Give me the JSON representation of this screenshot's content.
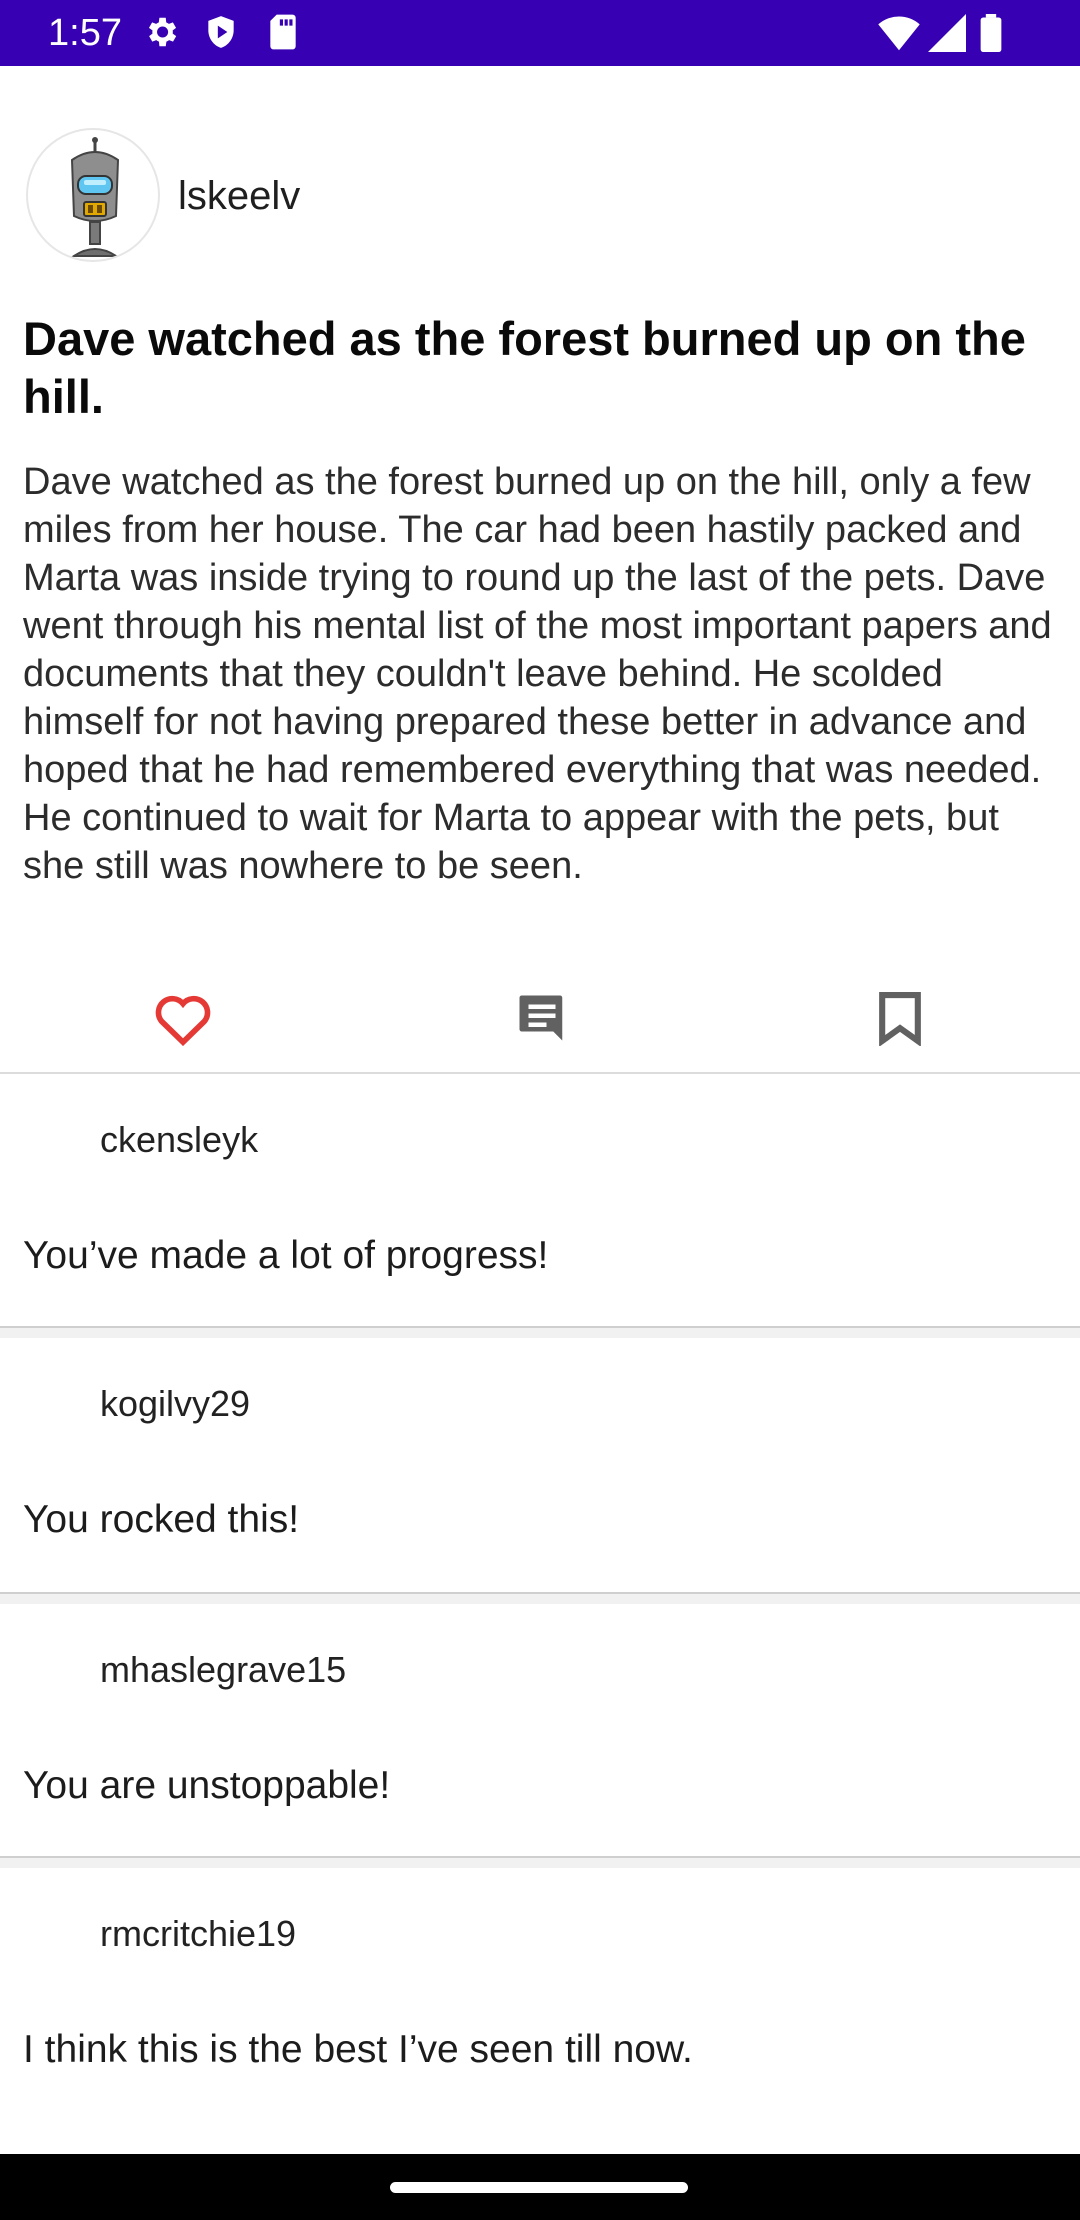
{
  "status_bar": {
    "time": "1:57",
    "icons": [
      "gear-icon",
      "shield-play-icon",
      "sd-card-icon"
    ],
    "right_icons": [
      "wifi-icon",
      "signal-icon",
      "battery-icon"
    ],
    "background": "#3700b3"
  },
  "post": {
    "author": "lskeelv",
    "avatar_icon": "robot-avatar-icon",
    "title": "Dave watched as the forest burned up on the hill.",
    "body": "Dave watched as the forest burned up on the hill, only a few miles from her house. The car had been hastily packed and Marta was inside trying to round up the last of the pets. Dave went through his mental list of the most important papers and documents that they couldn't leave behind. He scolded himself for not having prepared these better in advance and hoped that he had remembered everything that was needed. He continued to wait for Marta to appear with the pets, but she still was nowhere to be seen."
  },
  "actions": {
    "like_icon": "heart-outline-icon",
    "comment_icon": "comment-icon",
    "bookmark_icon": "bookmark-outline-icon",
    "like_color": "#e53935",
    "icon_color": "#616161"
  },
  "comments": [
    {
      "user": "ckensleyk",
      "text": "You’ve made a lot of progress!"
    },
    {
      "user": "kogilvy29",
      "text": "You rocked this!"
    },
    {
      "user": "mhaslegrave15",
      "text": "You are unstoppable!"
    },
    {
      "user": "rmcritchie19",
      "text": "I think this is the best I’ve seen till now."
    }
  ]
}
